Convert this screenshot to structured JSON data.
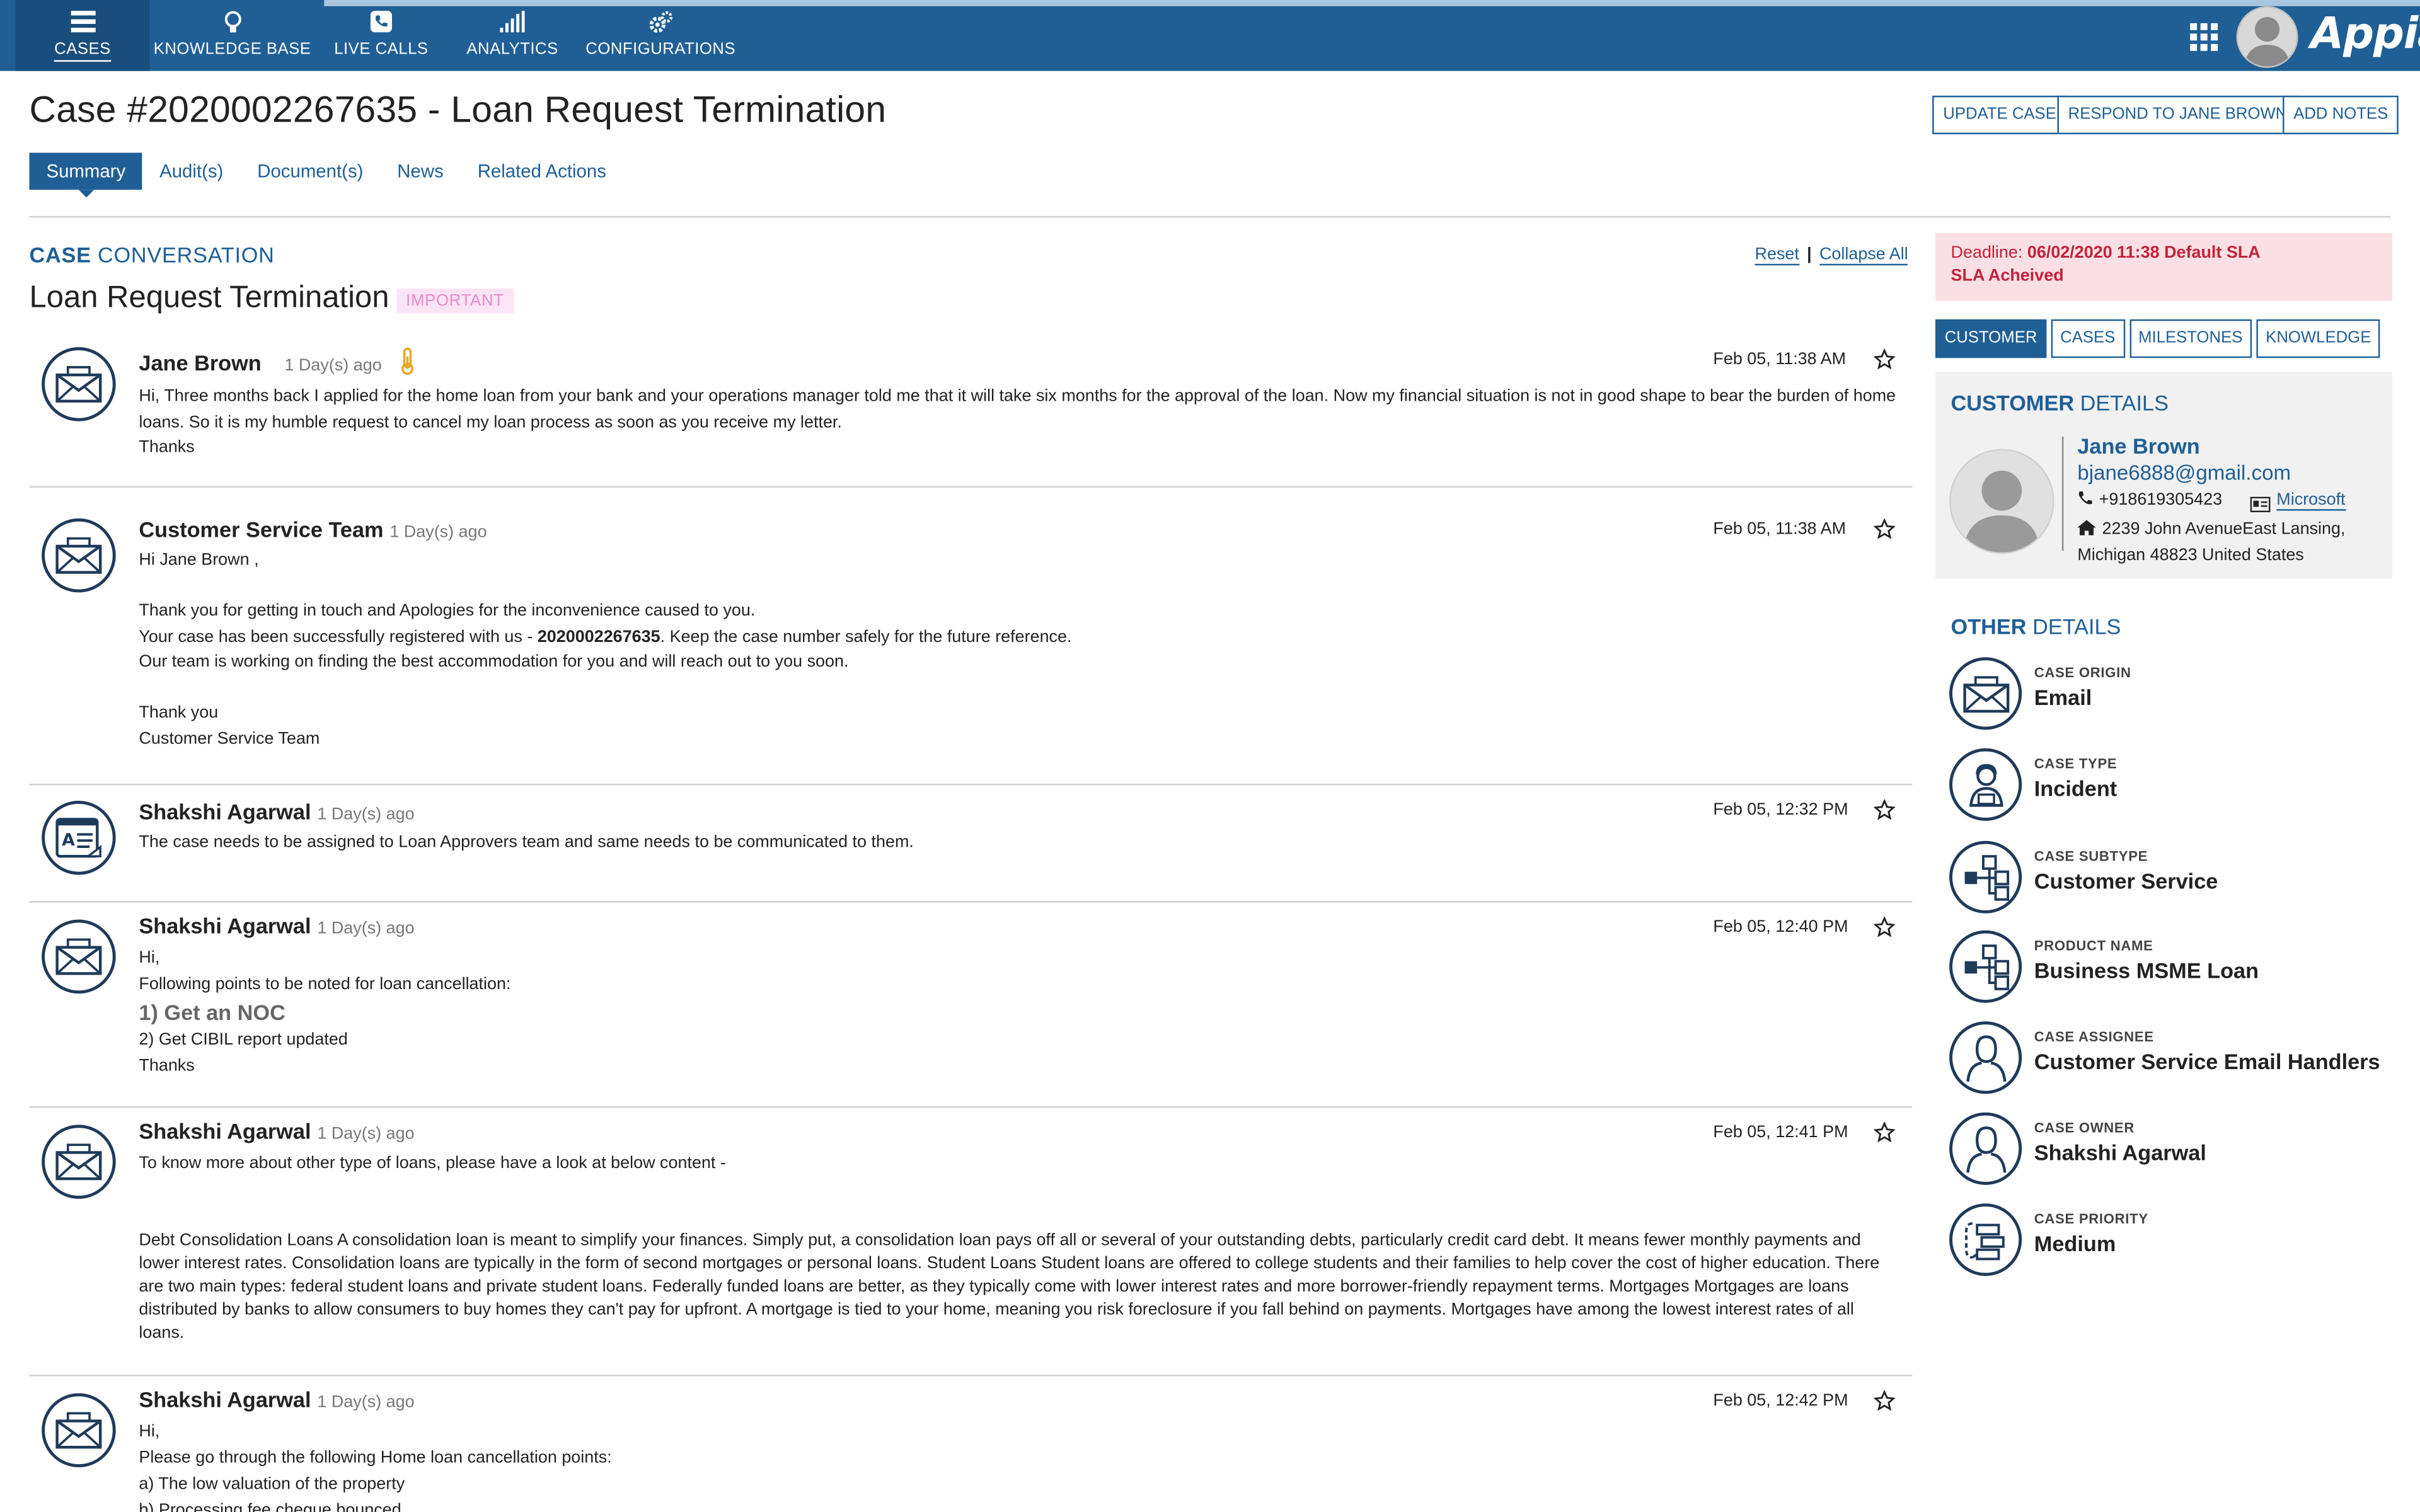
{
  "nav": {
    "items": [
      {
        "label": "CASES",
        "icon": "list-icon"
      },
      {
        "label": "KNOWLEDGE BASE",
        "icon": "lightbulb-icon"
      },
      {
        "label": "LIVE CALLS",
        "icon": "phone-icon"
      },
      {
        "label": "ANALYTICS",
        "icon": "bar-chart-icon"
      },
      {
        "label": "CONFIGURATIONS",
        "icon": "gears-icon"
      }
    ],
    "logo": "Appian"
  },
  "header": {
    "title": "Case #2020002267635 - Loan Request Termination",
    "buttons": [
      "UPDATE CASE",
      "RESPOND TO JANE BROWN",
      "ADD NOTES"
    ]
  },
  "tabs": [
    "Summary",
    "Audit(s)",
    "Document(s)",
    "News",
    "Related Actions"
  ],
  "conversation": {
    "title_bold": "CASE",
    "title_rest": " CONVERSATION",
    "reset": "Reset",
    "collapse_all": "Collapse All",
    "subject": "Loan Request Termination",
    "badge": "IMPORTANT",
    "messages": [
      {
        "author": "Jane Brown",
        "ago": "1 Day(s) ago",
        "time": "Feb 05, 11:38 AM",
        "lines": [
          "Hi, Three months back I applied for the home loan from your bank and your operations manager told me that it will take six months for the approval of the loan. Now my financial situation is not in good shape to bear the burden of home loans. So it is my humble request to cancel my loan process as soon as you receive my letter.",
          "Thanks"
        ]
      },
      {
        "author": "Customer Service Team",
        "ago": "1 Day(s) ago",
        "time": "Feb 05, 11:38 AM",
        "line1": "Hi Jane Brown ,",
        "line2": "Thank you for getting in touch and Apologies for the inconvenience caused to you.",
        "line3_pre": "Your case has been successfully registered with us - ",
        "line3_bold": "2020002267635",
        "line3_post": ". Keep the case number safely for the future reference.",
        "line4": "Our team is working on finding the best accommodation for you and will reach out to you soon.",
        "line5": "Thank you",
        "line6": "Customer Service Team"
      },
      {
        "author": "Shakshi Agarwal",
        "ago": "1 Day(s) ago",
        "time": "Feb 05, 12:32 PM",
        "line1": "The case needs to be assigned to Loan Approvers team and same needs to be communicated to them."
      },
      {
        "author": "Shakshi Agarwal",
        "ago": "1 Day(s) ago",
        "time": "Feb 05, 12:40 PM",
        "line1": "Hi,",
        "line2": "Following points to be noted for loan cancellation:",
        "line3": "1) Get an NOC",
        "line4": "2) Get CIBIL report updated",
        "line5": "Thanks"
      },
      {
        "author": "Shakshi Agarwal",
        "ago": "1 Day(s) ago",
        "time": "Feb 05, 12:41 PM",
        "line1": "To know more about other type of loans, please have a look at below content -",
        "line2": "Debt Consolidation Loans A consolidation loan is meant to simplify your finances. Simply put, a consolidation loan pays off all or several of your outstanding debts, particularly credit card debt. It means fewer monthly payments and lower interest rates. Consolidation loans are typically in the form of second mortgages or personal loans. Student Loans Student loans are offered to college students and their families to help cover the cost of higher education. There are two main types: federal student loans and private student loans. Federally funded loans are better, as they typically come with lower interest rates and more borrower-friendly repayment terms. Mortgages Mortgages are loans distributed by banks to allow consumers to buy homes they can't pay for upfront. A mortgage is tied to your home, meaning you risk foreclosure if you fall behind on payments. Mortgages have among the lowest interest rates of all loans."
      },
      {
        "author": "Shakshi Agarwal",
        "ago": "1 Day(s) ago",
        "time": "Feb 05, 12:42 PM",
        "line1": "Hi,",
        "line2": "Please go through the following Home loan cancellation points:",
        "line3": "a) The low valuation of the property",
        "line4": "b) Processing fee cheque bounced"
      }
    ]
  },
  "deadline": {
    "label": "Deadline: ",
    "value": "06/02/2020 11:38 Default SLA",
    "status": "SLA Acheived"
  },
  "right_tabs": [
    "CUSTOMER",
    "CASES",
    "MILESTONES",
    "KNOWLEDGE"
  ],
  "customer": {
    "title_bold": "CUSTOMER",
    "title_rest": " DETAILS",
    "name": "Jane Brown",
    "email": "bjane6888@gmail.com",
    "phone": "+918619305423",
    "company": "Microsoft",
    "address": "2239  John AvenueEast Lansing, Michigan 48823 United States"
  },
  "other_details": {
    "title_bold": "OTHER",
    "title_rest": " DETAILS",
    "items": [
      {
        "label": "CASE ORIGIN",
        "value": "Email",
        "icon": "envelope-icon"
      },
      {
        "label": "CASE TYPE",
        "value": "Incident",
        "icon": "agent-icon"
      },
      {
        "label": "CASE SUBTYPE",
        "value": "Customer Service",
        "icon": "hierarchy-icon"
      },
      {
        "label": "PRODUCT NAME",
        "value": "Business MSME Loan",
        "icon": "hierarchy-icon"
      },
      {
        "label": "CASE ASSIGNEE",
        "value": "Customer Service Email Handlers",
        "icon": "person-icon"
      },
      {
        "label": "CASE OWNER",
        "value": "Shakshi Agarwal",
        "icon": "person-icon"
      },
      {
        "label": "CASE PRIORITY",
        "value": "Medium",
        "icon": "priority-icon"
      }
    ]
  },
  "colors": {
    "brand": "#1f5f96",
    "deadline_bg": "#fae0e4",
    "deadline_text": "#c4213b",
    "important": "#e98ad0"
  }
}
